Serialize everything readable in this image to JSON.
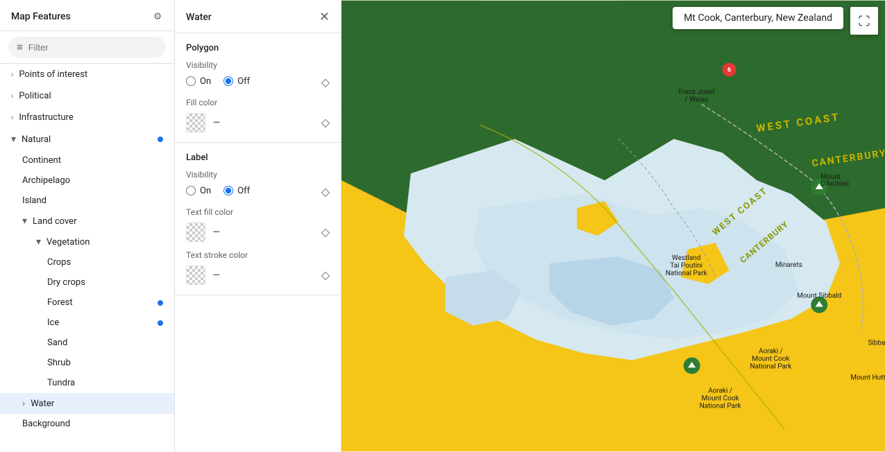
{
  "sidebar": {
    "title": "Map Features",
    "filter_placeholder": "Filter",
    "items": [
      {
        "id": "poi",
        "label": "Points of interest",
        "expanded": false,
        "level": 0
      },
      {
        "id": "political",
        "label": "Political",
        "expanded": false,
        "level": 0
      },
      {
        "id": "infrastructure",
        "label": "Infrastructure",
        "expanded": false,
        "level": 0
      },
      {
        "id": "natural",
        "label": "Natural",
        "expanded": true,
        "level": 0,
        "has_dot": true,
        "children": [
          {
            "id": "continent",
            "label": "Continent",
            "level": 1
          },
          {
            "id": "archipelago",
            "label": "Archipelago",
            "level": 1
          },
          {
            "id": "island",
            "label": "Island",
            "level": 1
          },
          {
            "id": "landcover",
            "label": "Land cover",
            "expanded": true,
            "level": 1,
            "children": [
              {
                "id": "vegetation",
                "label": "Vegetation",
                "expanded": true,
                "level": 2,
                "children": [
                  {
                    "id": "crops",
                    "label": "Crops",
                    "level": 3
                  },
                  {
                    "id": "drycrops",
                    "label": "Dry crops",
                    "level": 3
                  },
                  {
                    "id": "forest",
                    "label": "Forest",
                    "level": 3,
                    "has_dot": true
                  },
                  {
                    "id": "ice",
                    "label": "Ice",
                    "level": 3,
                    "has_dot": true
                  },
                  {
                    "id": "sand",
                    "label": "Sand",
                    "level": 3
                  },
                  {
                    "id": "shrub",
                    "label": "Shrub",
                    "level": 3
                  },
                  {
                    "id": "tundra",
                    "label": "Tundra",
                    "level": 3
                  }
                ]
              }
            ]
          },
          {
            "id": "water",
            "label": "Water",
            "level": 1,
            "active": true
          },
          {
            "id": "background",
            "label": "Background",
            "level": 1
          }
        ]
      }
    ]
  },
  "panel": {
    "title": "Water",
    "polygon_section": {
      "title": "Polygon",
      "visibility_label": "Visibility",
      "visibility_on": "On",
      "visibility_off": "Off",
      "fill_color_label": "Fill color",
      "fill_color_value": "–"
    },
    "label_section": {
      "title": "Label",
      "visibility_label": "Visibility",
      "visibility_on": "On",
      "visibility_off": "Off",
      "text_fill_color_label": "Text fill color",
      "text_fill_color_value": "–",
      "text_stroke_color_label": "Text stroke color",
      "text_stroke_color_value": "–"
    }
  },
  "map": {
    "location": "Mt Cook, Canterbury, New Zealand"
  },
  "icons": {
    "gear": "⚙",
    "filter": "≡",
    "close": "✕",
    "diamond": "◇",
    "fullscreen": "⛶",
    "chevron_right": "›",
    "chevron_down": "⌄"
  }
}
